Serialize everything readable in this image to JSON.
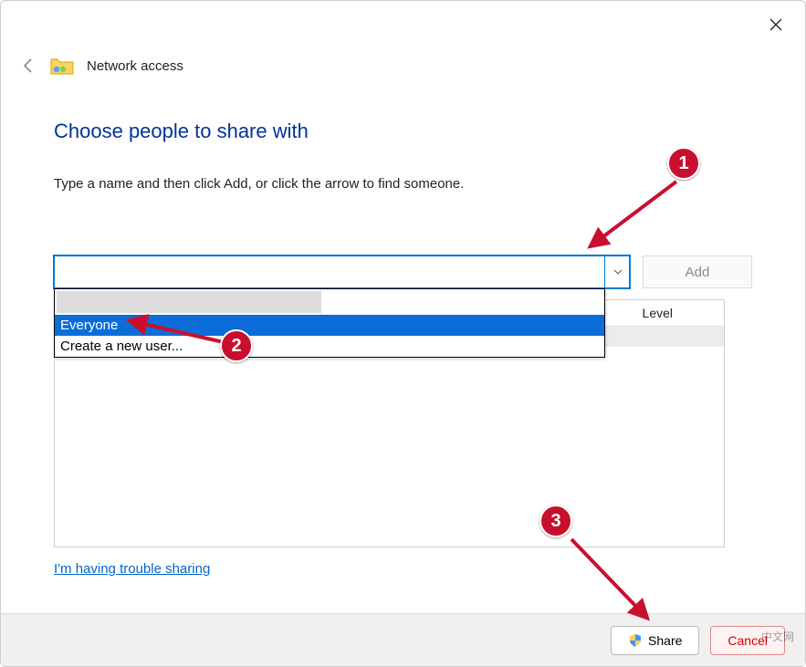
{
  "window": {
    "close_tooltip": "Close"
  },
  "header": {
    "title": "Network access"
  },
  "main": {
    "heading": "Choose people to share with",
    "instruction": "Type a name and then click Add, or click the arrow to find someone.",
    "combo_value": "",
    "add_label": "Add",
    "permission_col": "Level",
    "dropdown": {
      "item_redacted": "",
      "item_everyone": "Everyone",
      "item_create": "Create a new user..."
    },
    "trouble_link": "I'm having trouble sharing"
  },
  "footer": {
    "share_label": "Share",
    "cancel_label": "Cancel"
  },
  "annotations": {
    "m1": "1",
    "m2": "2",
    "m3": "3"
  },
  "watermark": "中文网"
}
